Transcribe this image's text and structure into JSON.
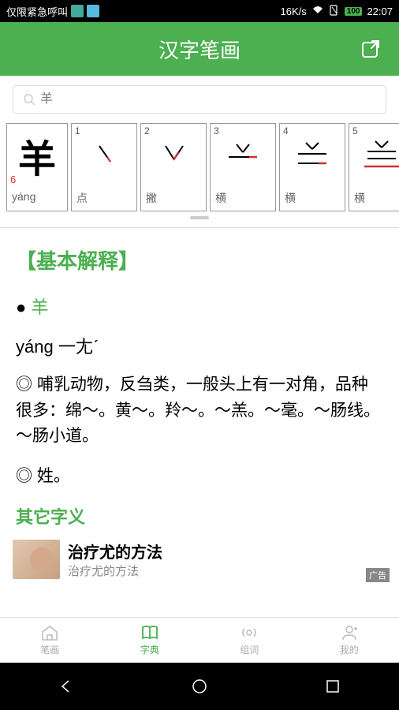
{
  "statusBar": {
    "leftText": "仅限紧急呼叫",
    "speed": "16K/s",
    "battery": "100",
    "time": "22:07"
  },
  "header": {
    "title": "汉字笔画"
  },
  "search": {
    "placeholder": "羊"
  },
  "strokes": {
    "mainChar": "羊",
    "mainCount": "6",
    "mainPinyin": "yáng",
    "items": [
      {
        "num": "1",
        "label": "点"
      },
      {
        "num": "2",
        "label": "撇"
      },
      {
        "num": "3",
        "label": "横"
      },
      {
        "num": "4",
        "label": "横"
      },
      {
        "num": "5",
        "label": "横"
      }
    ]
  },
  "content": {
    "sectionTitle": "【基本解释】",
    "bulletPrefix": "● ",
    "bulletChar": "羊",
    "pinyin": "yáng 一尢ˊ",
    "def1": "◎ 哺乳动物，反刍类，一般头上有一对角，品种很多：绵～。黄～。羚～。～羔。～毫。～肠线。～肠小道。",
    "def2": "◎ 姓。",
    "subTitle": "其它字义"
  },
  "ad": {
    "title": "治疗尤的方法",
    "sub": "治疗尤的方法",
    "badge": "广告"
  },
  "tabs": [
    {
      "label": "笔画",
      "active": false
    },
    {
      "label": "字典",
      "active": true
    },
    {
      "label": "组词",
      "active": false
    },
    {
      "label": "我的",
      "active": false
    }
  ]
}
